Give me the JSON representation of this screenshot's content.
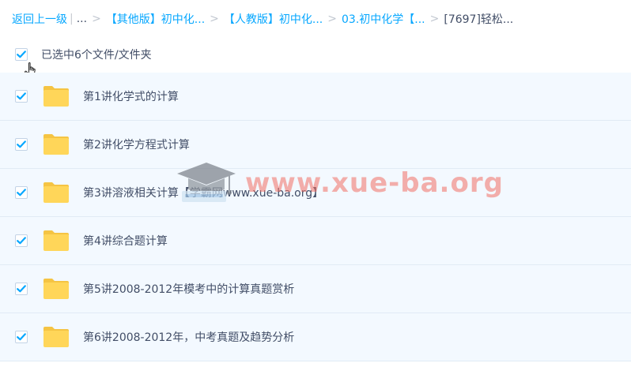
{
  "breadcrumb": {
    "back_label": "返回上一级",
    "divider": "|",
    "ellipsis": "...",
    "items": [
      {
        "label": "【其他版】初中化..."
      },
      {
        "label": "【人教版】初中化..."
      },
      {
        "label": "03.初中化学【..."
      }
    ],
    "current": "[7697]轻松...",
    "separator": ">"
  },
  "selection": {
    "checked": true,
    "label": "已选中6个文件/文件夹"
  },
  "files": [
    {
      "name": "第1讲化学式的计算",
      "type": "folder",
      "checked": true
    },
    {
      "name": "第2讲化学方程式计算",
      "type": "folder",
      "checked": true
    },
    {
      "name": "第3讲溶液相关计算【学霸网www.xue-ba.org】",
      "type": "folder",
      "checked": true
    },
    {
      "name": "第4讲综合题计算",
      "type": "folder",
      "checked": true
    },
    {
      "name": "第5讲2008-2012年模考中的计算真题赏析",
      "type": "folder",
      "checked": true
    },
    {
      "name": "第6讲2008-2012年，中考真题及趋势分析",
      "type": "folder",
      "checked": true
    }
  ],
  "watermark": {
    "text": "www.xue-ba.org",
    "icon": "graduation-cap-icon"
  },
  "colors": {
    "link": "#06a7ff",
    "text": "#424e67",
    "row_bg": "#f3f9ff",
    "folder": "#ffd659",
    "checkmark": "#06a7ff"
  }
}
